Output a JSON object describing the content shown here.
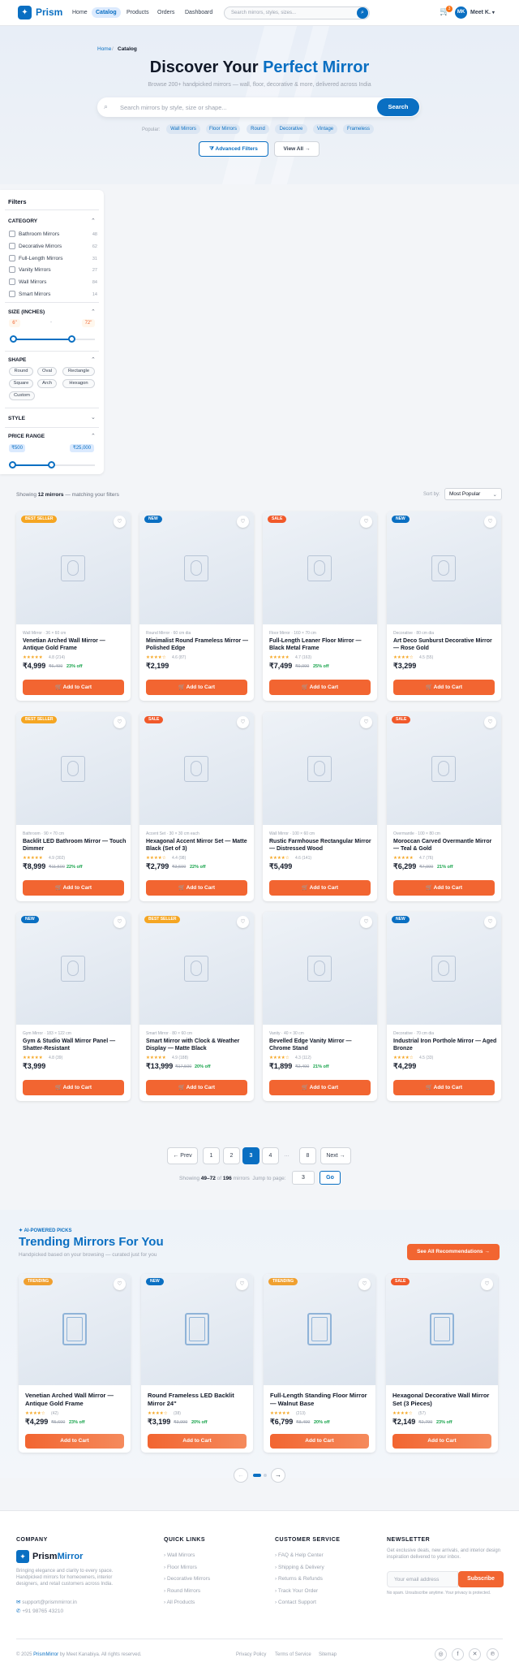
{
  "header": {
    "logo_icon": "mirror-logo-icon",
    "brand": "Prism",
    "nav": [
      "Home",
      "Catalog",
      "Products",
      "Orders",
      "Dashboard"
    ],
    "active_nav": "Catalog",
    "search_placeholder": "Search mirrors, styles, sizes...",
    "cart_count": "3",
    "avatar_initials": "MK",
    "user_name": "Meet K.",
    "accent_color": "#0a6fc2"
  },
  "hero": {
    "breadcrumb_home": "Home",
    "breadcrumb_sep": "/",
    "breadcrumb_current": "Catalog",
    "title_main": "Discover Your",
    "title_accent": "Perfect Mirror",
    "subtitle": "Browse 200+ handpicked mirrors — wall, floor, decorative & more, delivered across India",
    "search_placeholder": "Search mirrors by style, size or shape...",
    "search_button": "Search",
    "popular_label": "Popular:",
    "popular_chips": [
      "Wall Mirrors",
      "Floor Mirrors",
      "Round",
      "Decorative",
      "Vintage",
      "Frameless"
    ],
    "advanced_filters": "Advanced Filters",
    "view_all": "View All"
  },
  "filters": {
    "title": "Filters",
    "category_heading": "CATEGORY",
    "categories": [
      {
        "label": "Bathroom Mirrors",
        "count": "48"
      },
      {
        "label": "Decorative Mirrors",
        "count": "62"
      },
      {
        "label": "Full-Length Mirrors",
        "count": "31"
      },
      {
        "label": "Vanity Mirrors",
        "count": "27"
      },
      {
        "label": "Wall Mirrors",
        "count": "84"
      },
      {
        "label": "Smart Mirrors",
        "count": "14"
      }
    ],
    "size_heading": "SIZE (INCHES)",
    "size_min": "6\"",
    "size_max": "72\"",
    "size_sep": "-",
    "shape_heading": "SHAPE",
    "shapes": [
      "Round",
      "Oval",
      "Rectangle",
      "Square",
      "Arch",
      "Hexagon",
      "Custom"
    ],
    "style_heading": "STYLE",
    "price_heading": "PRICE RANGE",
    "price_min": "₹500",
    "price_max": "₹25,000"
  },
  "results": {
    "prefix": "Showing",
    "count": "12 mirrors",
    "suffix": "— matching your filters",
    "sort_label": "Sort by:",
    "sort_value": "Most Popular"
  },
  "products": [
    {
      "badge": "BEST SELLER",
      "badge_type": "best",
      "meta": "Wall Mirror · 36 × 60 cm",
      "name": "Venetian Arched Wall Mirror — Antique Gold Frame",
      "stars": "★★★★★",
      "rating": "4.8 (214)",
      "price": "₹4,999",
      "old": "₹6,499",
      "off": "23% off"
    },
    {
      "badge": "NEW",
      "badge_type": "new",
      "meta": "Round Mirror · 60 cm dia",
      "name": "Minimalist Round Frameless Mirror — Polished Edge",
      "stars": "★★★★☆",
      "rating": "4.6 (87)",
      "price": "₹2,199",
      "old": "",
      "off": ""
    },
    {
      "badge": "SALE",
      "badge_type": "sale",
      "meta": "Floor Mirror · 160 × 70 cm",
      "name": "Full-Length Leaner Floor Mirror — Black Metal Frame",
      "stars": "★★★★★",
      "rating": "4.7 (163)",
      "price": "₹7,499",
      "old": "₹9,999",
      "off": "25% off"
    },
    {
      "badge": "NEW",
      "badge_type": "new",
      "meta": "Decorative · 80 cm dia",
      "name": "Art Deco Sunburst Decorative Mirror — Rose Gold",
      "stars": "★★★★☆",
      "rating": "4.5 (55)",
      "price": "₹3,299",
      "old": "",
      "off": ""
    },
    {
      "badge": "BEST SELLER",
      "badge_type": "best",
      "meta": "Bathroom · 90 × 70 cm",
      "name": "Backlit LED Bathroom Mirror — Touch Dimmer",
      "stars": "★★★★★",
      "rating": "4.9 (302)",
      "price": "₹8,999",
      "old": "₹11,500",
      "off": "22% off"
    },
    {
      "badge": "SALE",
      "badge_type": "sale",
      "meta": "Accent Set · 30 × 30 cm each",
      "name": "Hexagonal Accent Mirror Set — Matte Black (Set of 3)",
      "stars": "★★★★☆",
      "rating": "4.4 (98)",
      "price": "₹2,799",
      "old": "₹3,599",
      "off": "22% off"
    },
    {
      "badge": "",
      "badge_type": "",
      "meta": "Wall Mirror · 100 × 60 cm",
      "name": "Rustic Farmhouse Rectangular Mirror — Distressed Wood",
      "stars": "★★★★☆",
      "rating": "4.6 (141)",
      "price": "₹5,499",
      "old": "",
      "off": ""
    },
    {
      "badge": "SALE",
      "badge_type": "sale",
      "meta": "Overmantle · 100 × 80 cm",
      "name": "Moroccan Carved Overmantle Mirror — Teal & Gold",
      "stars": "★★★★★",
      "rating": "4.7 (76)",
      "price": "₹6,299",
      "old": "₹7,999",
      "off": "21% off"
    },
    {
      "badge": "NEW",
      "badge_type": "new",
      "meta": "Gym Mirror · 183 × 122 cm",
      "name": "Gym & Studio Wall Mirror Panel — Shatter-Resistant",
      "stars": "★★★★★",
      "rating": "4.8 (39)",
      "price": "₹3,999",
      "old": "",
      "off": ""
    },
    {
      "badge": "BEST SELLER",
      "badge_type": "best",
      "meta": "Smart Mirror · 80 × 60 cm",
      "name": "Smart Mirror with Clock & Weather Display — Matte Black",
      "stars": "★★★★★",
      "rating": "4.9 (188)",
      "price": "₹13,999",
      "old": "₹17,500",
      "off": "20% off"
    },
    {
      "badge": "",
      "badge_type": "",
      "meta": "Vanity · 40 × 30 cm",
      "name": "Bevelled Edge Vanity Mirror — Chrome Stand",
      "stars": "★★★★☆",
      "rating": "4.3 (112)",
      "price": "₹1,899",
      "old": "₹2,400",
      "off": "21% off"
    },
    {
      "badge": "NEW",
      "badge_type": "new",
      "meta": "Decorative · 70 cm dia",
      "name": "Industrial Iron Porthole Mirror — Aged Bronze",
      "stars": "★★★★☆",
      "rating": "4.5 (33)",
      "price": "₹4,299",
      "old": "",
      "off": ""
    }
  ],
  "add_to_cart": "Add to Cart",
  "pagination": {
    "prev": "← Prev",
    "pages": [
      "1",
      "2",
      "3",
      "4",
      "…",
      "8"
    ],
    "active": "3",
    "next": "Next →",
    "info_prefix": "Showing",
    "info_range": "49–72",
    "info_of": "of",
    "info_total": "196",
    "info_suffix": "mirrors",
    "jump_label": "Jump to page:",
    "jump_value": "3",
    "go": "Go"
  },
  "trending": {
    "tag": "✦ AI-POWERED PICKS",
    "title": "Trending Mirrors For You",
    "subtitle": "Handpicked based on your browsing — curated just for you",
    "button": "See All Recommendations →",
    "items": [
      {
        "badge": "TRENDING",
        "badge_type": "trend",
        "name": "Venetian Arched Wall Mirror — Antique Gold Frame",
        "stars": "★★★★☆",
        "rating": "(42)",
        "price": "₹4,299",
        "old": "₹5,600",
        "off": "23% off"
      },
      {
        "badge": "NEW",
        "badge_type": "new",
        "name": "Round Frameless LED Backlit Mirror 24\"",
        "stars": "★★★★☆",
        "rating": "(38)",
        "price": "₹3,199",
        "old": "₹3,999",
        "off": "20% off"
      },
      {
        "badge": "TRENDING",
        "badge_type": "trend",
        "name": "Full-Length Standing Floor Mirror — Walnut Base",
        "stars": "★★★★★",
        "rating": "(213)",
        "price": "₹6,799",
        "old": "₹8,499",
        "off": "20% off"
      },
      {
        "badge": "SALE",
        "badge_type": "sale",
        "name": "Hexagonal Decorative Wall Mirror Set (3 Pieces)",
        "stars": "★★★★☆",
        "rating": "(57)",
        "price": "₹2,149",
        "old": "₹2,799",
        "off": "23% off"
      }
    ]
  },
  "footer": {
    "company_heading": "COMPANY",
    "brand_a": "Prism",
    "brand_b": "Mirror",
    "description": "Bringing elegance and clarity to every space. Handpicked mirrors for homeowners, interior designers, and retail customers across India.",
    "email": "support@prismmirror.in",
    "phone": "+91 98765 43210",
    "quick_heading": "QUICK LINKS",
    "quick_links": [
      "Wall Mirrors",
      "Floor Mirrors",
      "Decorative Mirrors",
      "Round Mirrors",
      "All Products"
    ],
    "service_heading": "CUSTOMER SERVICE",
    "service_links": [
      "FAQ & Help Center",
      "Shipping & Delivery",
      "Returns & Refunds",
      "Track Your Order",
      "Contact Support"
    ],
    "newsletter_heading": "NEWSLETTER",
    "newsletter_desc": "Get exclusive deals, new arrivals, and interior design inspiration delivered to your inbox.",
    "newsletter_placeholder": "Your email address",
    "subscribe": "Subscribe",
    "newsletter_note": "No spam. Unsubscribe anytime. Your privacy is protected.",
    "copyright_prefix": "© 2025",
    "copyright_brand": "PrismMirror",
    "copyright_suffix": "by Meet Kanabiya. All rights reserved.",
    "bottom_links": [
      "Privacy Policy",
      "Terms of Service",
      "Sitemap"
    ],
    "socials": [
      "instagram-icon",
      "facebook-icon",
      "twitter-icon",
      "pinterest-icon"
    ]
  }
}
